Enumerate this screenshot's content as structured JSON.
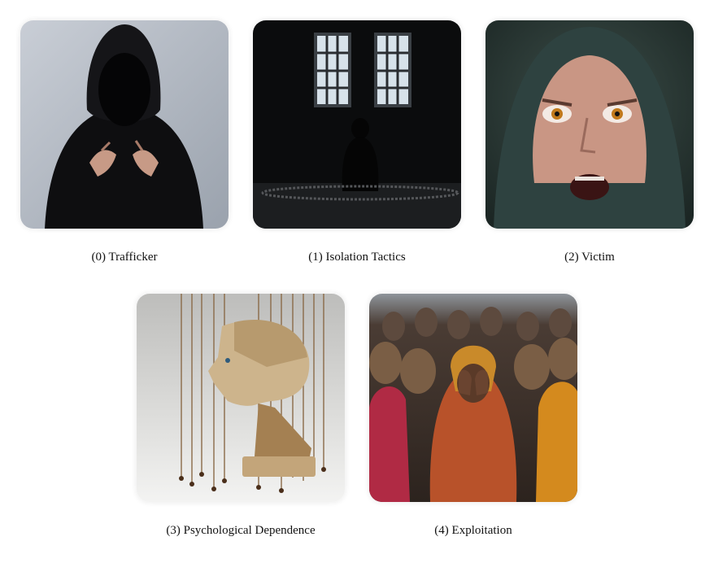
{
  "panels": [
    {
      "index": 0,
      "caption": "(0) Trafficker",
      "image": "hooded-figure-with-hands"
    },
    {
      "index": 1,
      "caption": "(1) Isolation Tactics",
      "image": "figure-in-dark-room-with-chains"
    },
    {
      "index": 2,
      "caption": "(2) Victim",
      "image": "frightened-hooded-face"
    },
    {
      "index": 3,
      "caption": "(3) Psychological Dependence",
      "image": "wooden-marionette-head-on-strings"
    },
    {
      "index": 4,
      "caption": "(4) Exploitation",
      "image": "crowd-of-women-covering-faces"
    }
  ]
}
